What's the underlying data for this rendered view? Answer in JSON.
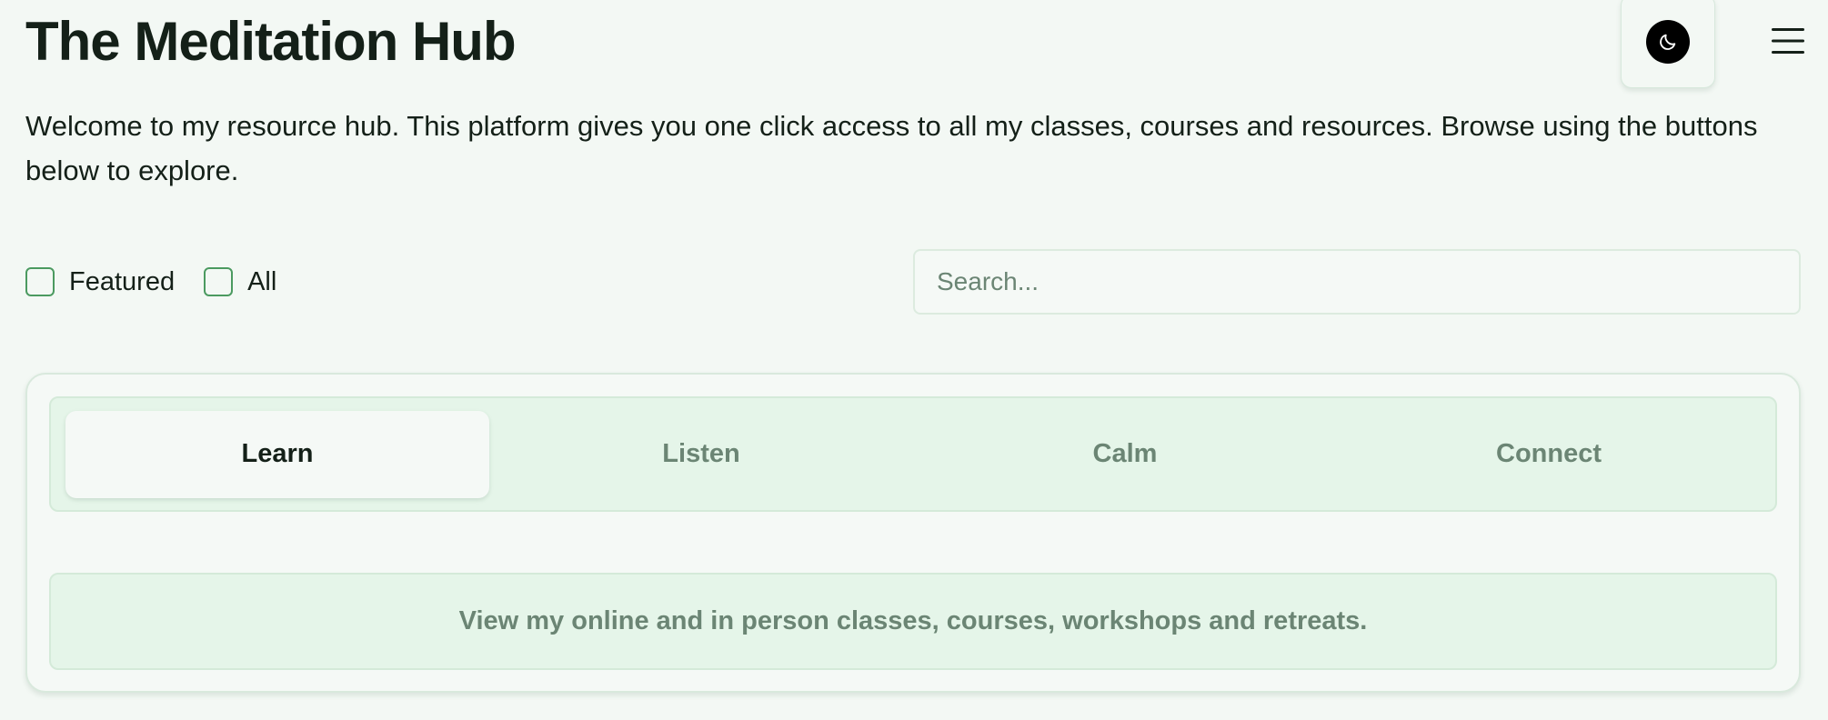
{
  "header": {
    "title": "The Meditation Hub",
    "theme_toggle_icon": "moon-icon",
    "menu_icon": "hamburger-menu-icon"
  },
  "intro": {
    "text": "Welcome to my resource hub. This platform gives you one click access to all my classes, courses and resources. Browse using the buttons below to explore."
  },
  "filters": [
    {
      "label": "Featured",
      "checked": false
    },
    {
      "label": "All",
      "checked": false
    }
  ],
  "search": {
    "placeholder": "Search...",
    "value": ""
  },
  "tabs": [
    {
      "label": "Learn",
      "active": true
    },
    {
      "label": "Listen",
      "active": false
    },
    {
      "label": "Calm",
      "active": false
    },
    {
      "label": "Connect",
      "active": false
    }
  ],
  "panel": {
    "description": "View my online and in person classes, courses, workshops and retreats."
  },
  "colors": {
    "background": "#f3f8f4",
    "accent_green": "#4b9a60",
    "tab_bar_bg": "#e5f5e9",
    "muted_text": "#6b8574",
    "heading_text": "#142018"
  }
}
